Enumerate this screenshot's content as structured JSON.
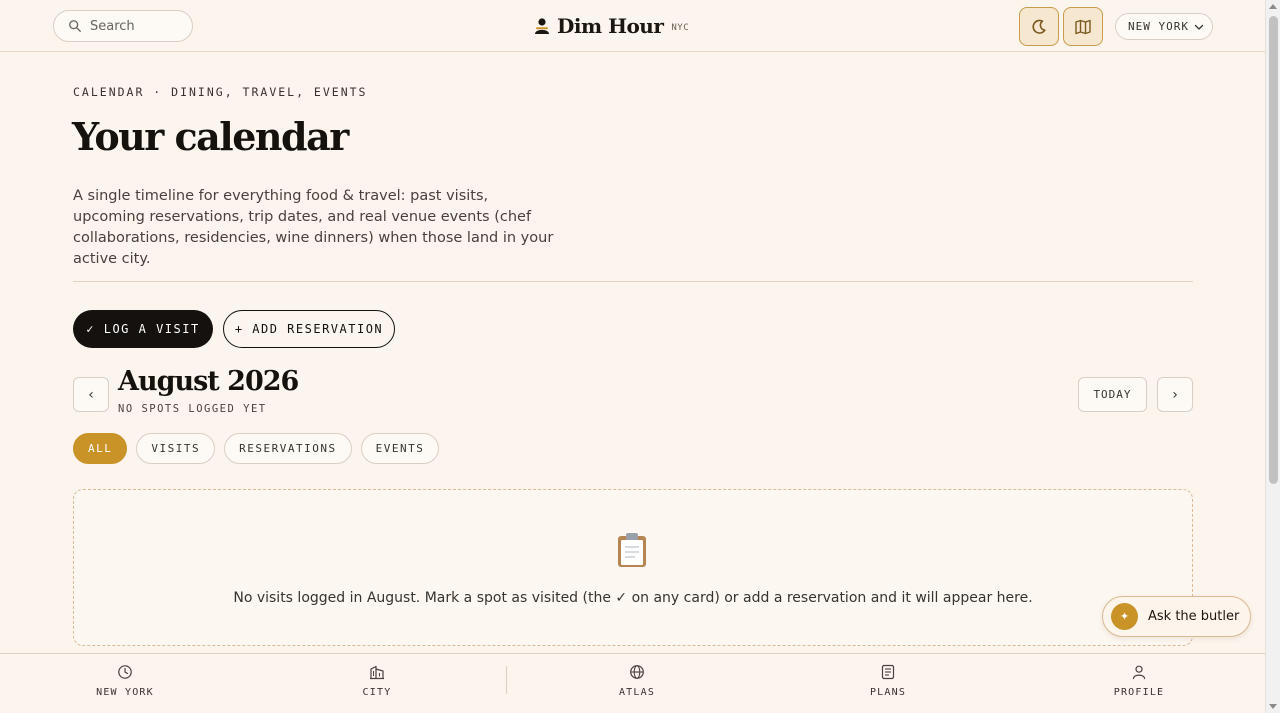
{
  "header": {
    "search_placeholder": "Search",
    "brand_name": "Dim Hour",
    "brand_city": "NYC",
    "city_select": "NEW YORK",
    "icons": [
      "search-icon",
      "moon-icon",
      "map-icon",
      "chevron-down-icon"
    ]
  },
  "main": {
    "eyebrow": "CALENDAR · DINING, TRAVEL, EVENTS",
    "title": "Your calendar",
    "intro": "A single timeline for everything food & travel: past visits, upcoming reservations, trip dates, and real venue events (chef collaborations, residencies, wine dinners) when those land in your active city.",
    "actions": {
      "log_visit": "✓ LOG A VISIT",
      "add_reservation": "+ ADD RESERVATION"
    },
    "calendar": {
      "prev": "‹",
      "next": "›",
      "today": "TODAY",
      "month": "August 2026",
      "subtitle": "NO SPOTS LOGGED YET"
    },
    "filters": [
      {
        "label": "ALL",
        "active": true
      },
      {
        "label": "VISITS",
        "active": false
      },
      {
        "label": "RESERVATIONS",
        "active": false
      },
      {
        "label": "EVENTS",
        "active": false
      }
    ],
    "empty_state": {
      "icon": "clipboard-icon",
      "text": "No visits logged in August. Mark a spot as visited (the ✓ on any card) or add a reservation and it will appear here."
    }
  },
  "butler": {
    "icon_glyph": "✦",
    "label": "Ask the butler"
  },
  "bottom_nav": {
    "items": [
      {
        "label": "NEW YORK",
        "icon": "clock-icon"
      },
      {
        "label": "CITY",
        "icon": "buildings-icon"
      },
      {
        "label": "ATLAS",
        "icon": "globe-icon"
      },
      {
        "label": "PLANS",
        "icon": "notes-icon"
      },
      {
        "label": "PROFILE",
        "icon": "person-icon"
      }
    ]
  },
  "colors": {
    "background": "#fcf5ee",
    "accent": "#c99328",
    "ink": "#14110e"
  }
}
